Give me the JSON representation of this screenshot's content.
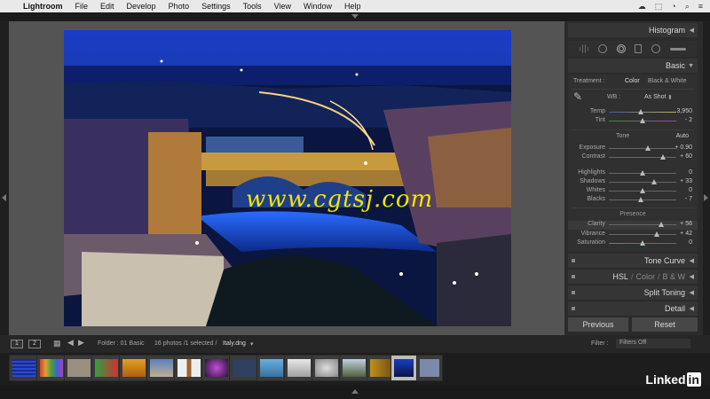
{
  "menubar": {
    "app": "Lightroom",
    "items": [
      "File",
      "Edit",
      "Develop",
      "Photo",
      "Settings",
      "Tools",
      "View",
      "Window",
      "Help"
    ]
  },
  "viewer": {
    "watermark": "www.cgtsj.com"
  },
  "panel": {
    "histogram_label": "Histogram",
    "basic_label": "Basic",
    "treatment_label": "Treatment :",
    "treatment_color": "Color",
    "treatment_bw": "Black & White",
    "wb_label": "WB :",
    "wb_value": "As Shot",
    "temp": {
      "label": "Temp",
      "value": "3,950",
      "level": 0.48
    },
    "tint": {
      "label": "Tint",
      "value": "- 2",
      "level": 0.5
    },
    "tone_label": "Tone",
    "auto_label": "Auto",
    "exposure": {
      "label": "Exposure",
      "value": "+ 0.90",
      "level": 0.58
    },
    "contrast": {
      "label": "Contrast",
      "value": "+ 60",
      "level": 0.8
    },
    "highlights": {
      "label": "Highlights",
      "value": "0",
      "level": 0.5
    },
    "shadows": {
      "label": "Shadows",
      "value": "+ 33",
      "level": 0.67
    },
    "whites": {
      "label": "Whites",
      "value": "0",
      "level": 0.5
    },
    "blacks": {
      "label": "Blacks",
      "value": "- 7",
      "level": 0.47
    },
    "presence_label": "Presence",
    "clarity": {
      "label": "Clarity",
      "value": "+ 56",
      "level": 0.78
    },
    "vibrance": {
      "label": "Vibrance",
      "value": "+ 42",
      "level": 0.71
    },
    "saturation": {
      "label": "Saturation",
      "value": "0",
      "level": 0.5
    },
    "tone_curve_label": "Tone Curve",
    "hsl_label": "HSL",
    "color_label": "Color",
    "bw_label": "B & W",
    "split_toning_label": "Split Toning",
    "detail_label": "Detail",
    "previous_label": "Previous",
    "reset_label": "Reset"
  },
  "filmbar": {
    "page1": "1",
    "page2": "2",
    "folder": "Folder : 01 Basic",
    "count": "16 photos /1 selected /",
    "filename": "Italy.dng",
    "filter_label": "Filter :",
    "filter_value": "Filters Off"
  },
  "brand": {
    "linked": "Linked",
    "in": "in"
  },
  "colors": {
    "accent_watermark": "#f0e600",
    "panel_bg": "#2b2b2b",
    "viewer_bg": "#545454"
  }
}
